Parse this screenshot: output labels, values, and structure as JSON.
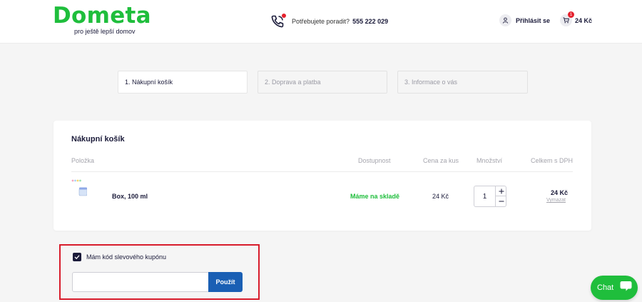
{
  "header": {
    "logo": "Dometa",
    "tagline": "pro ještě lepší domov",
    "phone_label": "Potřebujete poradit?",
    "phone_number": "555 222 029",
    "login": "Přihlásit se",
    "cart_count": "1",
    "cart_total": "24 Kč"
  },
  "steps": [
    "1. Nákupní košík",
    "2. Doprava a platba",
    "3. Informace o vás"
  ],
  "cart": {
    "title": "Nákupní košík",
    "columns": {
      "item": "Položka",
      "availability": "Dostupnost",
      "unit_price": "Cena za kus",
      "quantity": "Množství",
      "total": "Celkem s DPH"
    },
    "items": [
      {
        "name": "Box, 100 ml",
        "availability": "Máme na skladě",
        "unit_price": "24 Kč",
        "quantity": "1",
        "total": "24 Kč",
        "remove": "Vymazat"
      }
    ]
  },
  "coupon": {
    "label": "Mám kód slevového kupónu",
    "checked": true,
    "input_value": "",
    "button": "Použít"
  },
  "chat": {
    "label": "Chat"
  },
  "colors": {
    "brand_green": "#1fbe3c",
    "button_blue": "#1a5fb4",
    "highlight_red": "#d81c2b",
    "dark_text": "#1b1b3a"
  }
}
